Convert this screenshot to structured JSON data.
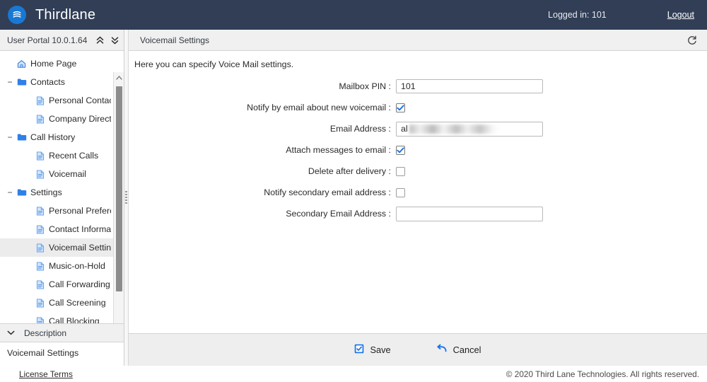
{
  "header": {
    "brand": "Thirdlane",
    "logo_icon": "thirdlane-logo-icon",
    "logged_in_label": "Logged in: 101",
    "logout_label": "Logout",
    "background_color": "#313e56",
    "accent_color": "#1878d4"
  },
  "sidebar": {
    "title": "User Portal 10.0.1.64",
    "collapse_all_icon": "double-chevron-up-icon",
    "expand_all_icon": "double-chevron-down-icon",
    "scroll_up_icon": "chevron-up-icon",
    "scroll_down_icon": "chevron-down-icon",
    "tree": [
      {
        "label": "Home Page",
        "icon": "home-icon",
        "level": 0,
        "toggle": "",
        "selected": false
      },
      {
        "label": "Contacts",
        "icon": "folder-icon",
        "level": 0,
        "toggle": "−",
        "selected": false
      },
      {
        "label": "Personal Contacts",
        "icon": "document-icon",
        "level": 2,
        "toggle": "",
        "selected": false
      },
      {
        "label": "Company Directory",
        "icon": "document-icon",
        "level": 2,
        "toggle": "",
        "selected": false
      },
      {
        "label": "Call History",
        "icon": "folder-icon",
        "level": 0,
        "toggle": "−",
        "selected": false
      },
      {
        "label": "Recent Calls",
        "icon": "document-icon",
        "level": 2,
        "toggle": "",
        "selected": false
      },
      {
        "label": "Voicemail",
        "icon": "document-icon",
        "level": 2,
        "toggle": "",
        "selected": false
      },
      {
        "label": "Settings",
        "icon": "folder-icon",
        "level": 0,
        "toggle": "−",
        "selected": false
      },
      {
        "label": "Personal Preferenc…",
        "icon": "document-icon",
        "level": 2,
        "toggle": "",
        "selected": false
      },
      {
        "label": "Contact Information",
        "icon": "document-icon",
        "level": 2,
        "toggle": "",
        "selected": false
      },
      {
        "label": "Voicemail Settings",
        "icon": "document-icon",
        "level": 2,
        "toggle": "",
        "selected": true
      },
      {
        "label": "Music-on-Hold",
        "icon": "document-icon",
        "level": 2,
        "toggle": "",
        "selected": false
      },
      {
        "label": "Call Forwarding",
        "icon": "document-icon",
        "level": 2,
        "toggle": "",
        "selected": false
      },
      {
        "label": "Call Screening",
        "icon": "document-icon",
        "level": 2,
        "toggle": "",
        "selected": false
      },
      {
        "label": "Call Blocking",
        "icon": "document-icon",
        "level": 2,
        "toggle": "",
        "selected": false
      }
    ],
    "description_panel": {
      "header_label": "Description",
      "chevron_icon": "chevron-down-icon",
      "body_text": "Voicemail Settings"
    }
  },
  "content": {
    "title": "Voicemail Settings",
    "refresh_icon": "refresh-icon",
    "intro_text": "Here you can specify Voice Mail settings.",
    "fields": {
      "mailbox_pin": {
        "label": "Mailbox PIN :",
        "value": "101",
        "placeholder": ""
      },
      "notify_new_voicemail": {
        "label": "Notify by email about new voicemail :",
        "checked": true
      },
      "email_address": {
        "label": "Email Address :",
        "value": "al",
        "redacted": true,
        "placeholder": ""
      },
      "attach_messages": {
        "label": "Attach messages to email :",
        "checked": true
      },
      "delete_after_delivery": {
        "label": "Delete after delivery :",
        "checked": false
      },
      "notify_secondary": {
        "label": "Notify secondary email address :",
        "checked": false
      },
      "secondary_email": {
        "label": "Secondary Email Address :",
        "value": "",
        "placeholder": ""
      }
    },
    "actions": {
      "save_label": "Save",
      "save_icon": "save-checkbox-icon",
      "cancel_label": "Cancel",
      "cancel_icon": "undo-arrow-icon"
    }
  },
  "footer": {
    "license_label": "License Terms",
    "copyright": "© 2020 Third Lane Technologies. All rights reserved."
  }
}
